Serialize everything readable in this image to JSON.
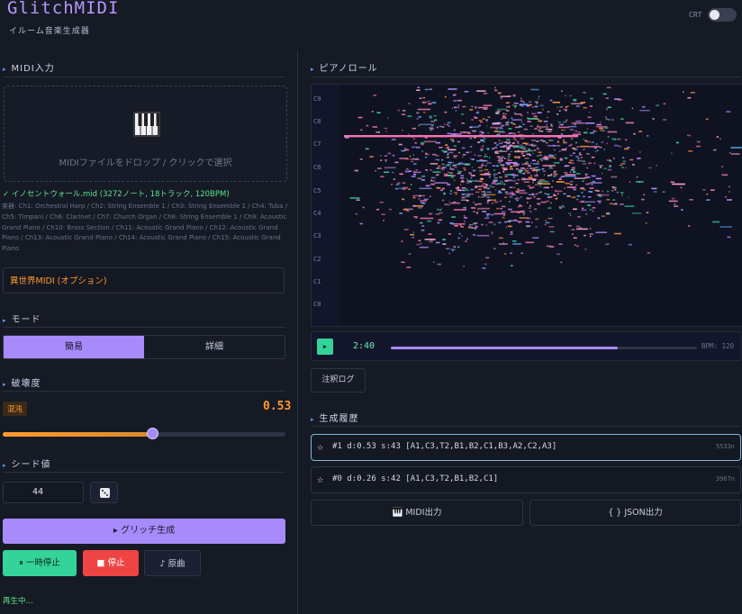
{
  "header": {
    "title": "GlitchMIDI",
    "subtitle": "イルーム音楽生成器",
    "crt_label": "CRT",
    "crt_on": false
  },
  "input": {
    "section_label": "MIDI入力",
    "drop_text": "MIDIファイルをドロップ / クリックで選択",
    "file_info": "✓ イノセントウォール.mid (3272ノート, 18トラック, 120BPM)",
    "instruments_text": "楽器: Ch1: Orchestral Harp / Ch2: String Ensemble 1 / Ch3: String Ensemble 1 / Ch4: Tuba / Ch5: Timpani / Ch6: Clarinet / Ch7: Church Organ / Ch8: String Ensemble 1 / Ch9: Acoustic Grand Piano / Ch10: Brass Section / Ch11: Acoustic Grand Piano / Ch12: Acoustic Grand Piano / Ch13: Acoustic Grand Piano / Ch14: Acoustic Grand Piano / Ch15: Acoustic Grand Piano",
    "isekai_button": "異世界MIDI (オプション)"
  },
  "mode": {
    "section_label": "モード",
    "simple": "簡易",
    "detail": "詳細",
    "selected": "simple"
  },
  "destruction": {
    "section_label": "破壊度",
    "badge": "混沌",
    "value_text": "0.53",
    "value": 0.53
  },
  "seed": {
    "section_label": "シード値",
    "value": "44"
  },
  "actions": {
    "glitch": "▸ グリッチ生成",
    "pause": "⏸ 一時停止",
    "stop": "■ 停止",
    "original": "♪ 原曲"
  },
  "status": "再生中…",
  "piano_roll": {
    "section_label": "ピアノロール",
    "octave_labels": [
      "C9",
      "C8",
      "C7",
      "C6",
      "C5",
      "C4",
      "C3",
      "C2",
      "C1",
      "C0"
    ]
  },
  "transport": {
    "play_icon": "▶",
    "time": "2:40",
    "progress": 0.74,
    "bpm": "BPM: 120"
  },
  "log_button": "注釈ログ",
  "history": {
    "section_label": "生成履歴",
    "items": [
      {
        "star": "☆",
        "text": "#1 d:0.53 s:43 [A1,C3,T2,B1,B2,C1,B3,A2,C2,A3]",
        "size": "5533n"
      },
      {
        "star": "☆",
        "text": "#0 d:0.26 s:42 [A1,C3,T2,B1,B2,C1]",
        "size": "3967n"
      }
    ]
  },
  "export": {
    "midi": "🎹 MIDI出力",
    "json": "{ } JSON出力"
  },
  "colors": {
    "accent": "#a78bfa",
    "orange": "#ff9a2e",
    "green": "#34d399",
    "red": "#ef4444",
    "background": "#161a25"
  }
}
